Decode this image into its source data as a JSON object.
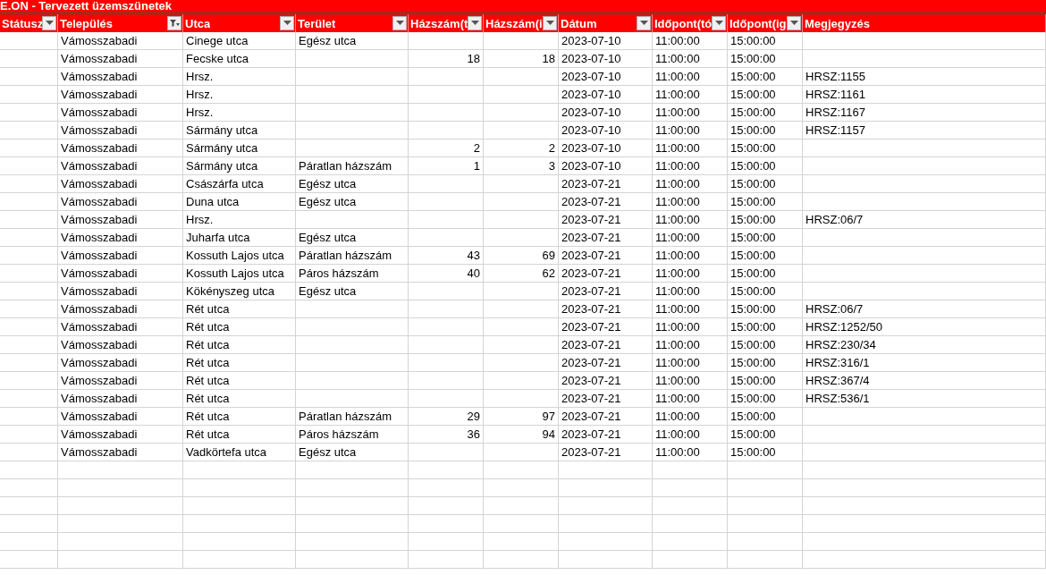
{
  "title": "E.ON - Tervezett üzemszünetek",
  "columns": [
    {
      "label": "Státusz",
      "kind": "text",
      "filtered": false
    },
    {
      "label": "Település",
      "kind": "text",
      "filtered": true
    },
    {
      "label": "Utca",
      "kind": "text",
      "filtered": false
    },
    {
      "label": "Terület",
      "kind": "text",
      "filtered": false
    },
    {
      "label": "Házszám(t",
      "kind": "number",
      "filtered": false
    },
    {
      "label": "Házszám(i",
      "kind": "number",
      "filtered": false
    },
    {
      "label": "Dátum",
      "kind": "text",
      "filtered": false
    },
    {
      "label": "Időpont(tó",
      "kind": "text",
      "filtered": false
    },
    {
      "label": "Időpont(ig",
      "kind": "text",
      "filtered": false
    },
    {
      "label": "Megjegyzés",
      "kind": "text"
    }
  ],
  "rows": [
    [
      null,
      "Vámosszabadi",
      "Cinege utca",
      "Egész utca",
      null,
      null,
      "2023-07-10",
      "11:00:00",
      "15:00:00",
      null
    ],
    [
      null,
      "Vámosszabadi",
      "Fecske utca",
      null,
      "18",
      "18",
      "2023-07-10",
      "11:00:00",
      "15:00:00",
      null
    ],
    [
      null,
      "Vámosszabadi",
      "Hrsz.",
      null,
      null,
      null,
      "2023-07-10",
      "11:00:00",
      "15:00:00",
      "HRSZ:1155"
    ],
    [
      null,
      "Vámosszabadi",
      "Hrsz.",
      null,
      null,
      null,
      "2023-07-10",
      "11:00:00",
      "15:00:00",
      "HRSZ:1161"
    ],
    [
      null,
      "Vámosszabadi",
      "Hrsz.",
      null,
      null,
      null,
      "2023-07-10",
      "11:00:00",
      "15:00:00",
      "HRSZ:1167"
    ],
    [
      null,
      "Vámosszabadi",
      "Sármány utca",
      null,
      null,
      null,
      "2023-07-10",
      "11:00:00",
      "15:00:00",
      "HRSZ:1157"
    ],
    [
      null,
      "Vámosszabadi",
      "Sármány utca",
      null,
      "2",
      "2",
      "2023-07-10",
      "11:00:00",
      "15:00:00",
      null
    ],
    [
      null,
      "Vámosszabadi",
      "Sármány utca",
      "Páratlan házszám",
      "1",
      "3",
      "2023-07-10",
      "11:00:00",
      "15:00:00",
      null
    ],
    [
      null,
      "Vámosszabadi",
      "Császárfa utca",
      "Egész utca",
      null,
      null,
      "2023-07-21",
      "11:00:00",
      "15:00:00",
      null
    ],
    [
      null,
      "Vámosszabadi",
      "Duna utca",
      "Egész utca",
      null,
      null,
      "2023-07-21",
      "11:00:00",
      "15:00:00",
      null
    ],
    [
      null,
      "Vámosszabadi",
      "Hrsz.",
      null,
      null,
      null,
      "2023-07-21",
      "11:00:00",
      "15:00:00",
      "HRSZ:06/7"
    ],
    [
      null,
      "Vámosszabadi",
      "Juharfa utca",
      "Egész utca",
      null,
      null,
      "2023-07-21",
      "11:00:00",
      "15:00:00",
      null
    ],
    [
      null,
      "Vámosszabadi",
      "Kossuth Lajos utca",
      "Páratlan házszám",
      "43",
      "69",
      "2023-07-21",
      "11:00:00",
      "15:00:00",
      null
    ],
    [
      null,
      "Vámosszabadi",
      "Kossuth Lajos utca",
      "Páros házszám",
      "40",
      "62",
      "2023-07-21",
      "11:00:00",
      "15:00:00",
      null
    ],
    [
      null,
      "Vámosszabadi",
      "Kökényszeg utca",
      "Egész utca",
      null,
      null,
      "2023-07-21",
      "11:00:00",
      "15:00:00",
      null
    ],
    [
      null,
      "Vámosszabadi",
      "Rét utca",
      null,
      null,
      null,
      "2023-07-21",
      "11:00:00",
      "15:00:00",
      "HRSZ:06/7"
    ],
    [
      null,
      "Vámosszabadi",
      "Rét utca",
      null,
      null,
      null,
      "2023-07-21",
      "11:00:00",
      "15:00:00",
      "HRSZ:1252/50"
    ],
    [
      null,
      "Vámosszabadi",
      "Rét utca",
      null,
      null,
      null,
      "2023-07-21",
      "11:00:00",
      "15:00:00",
      "HRSZ:230/34"
    ],
    [
      null,
      "Vámosszabadi",
      "Rét utca",
      null,
      null,
      null,
      "2023-07-21",
      "11:00:00",
      "15:00:00",
      "HRSZ:316/1"
    ],
    [
      null,
      "Vámosszabadi",
      "Rét utca",
      null,
      null,
      null,
      "2023-07-21",
      "11:00:00",
      "15:00:00",
      "HRSZ:367/4"
    ],
    [
      null,
      "Vámosszabadi",
      "Rét utca",
      null,
      null,
      null,
      "2023-07-21",
      "11:00:00",
      "15:00:00",
      "HRSZ:536/1"
    ],
    [
      null,
      "Vámosszabadi",
      "Rét utca",
      "Páratlan házszám",
      "29",
      "97",
      "2023-07-21",
      "11:00:00",
      "15:00:00",
      null
    ],
    [
      null,
      "Vámosszabadi",
      "Rét utca",
      "Páros házszám",
      "36",
      "94",
      "2023-07-21",
      "11:00:00",
      "15:00:00",
      null
    ],
    [
      null,
      "Vámosszabadi",
      "Vadkörtefa utca",
      "Egész utca",
      null,
      null,
      "2023-07-21",
      "11:00:00",
      "15:00:00",
      null
    ]
  ]
}
